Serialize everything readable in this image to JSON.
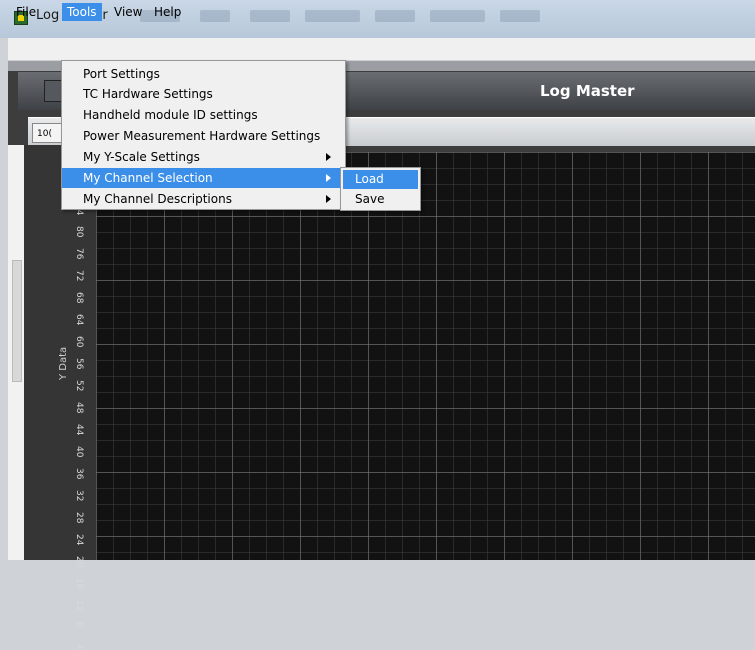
{
  "window": {
    "title": "Log Master"
  },
  "menubar": [
    {
      "label": "File"
    },
    {
      "label": "Tools"
    },
    {
      "label": "View"
    },
    {
      "label": "Help"
    }
  ],
  "app": {
    "header_title": "Log Master",
    "tab_label": "10("
  },
  "tools_menu": {
    "items": [
      {
        "label": "Port Settings",
        "submenu": false
      },
      {
        "label": "TC Hardware Settings",
        "submenu": false
      },
      {
        "label": "Handheld module  ID settings",
        "submenu": false
      },
      {
        "label": "Power Measurement Hardware Settings",
        "submenu": false
      },
      {
        "label": "My Y-Scale Settings",
        "submenu": true
      },
      {
        "label": "My Channel Selection",
        "submenu": true,
        "highlighted": true
      },
      {
        "label": "My Channel Descriptions",
        "submenu": true
      }
    ]
  },
  "channel_selection_submenu": {
    "items": [
      {
        "label": "Load",
        "highlighted": true
      },
      {
        "label": "Save"
      }
    ]
  },
  "plot": {
    "y_axis_label": "Y Data",
    "y_ticks": [
      "84",
      "80",
      "76",
      "72",
      "68",
      "64",
      "60",
      "56",
      "52",
      "48",
      "44",
      "40",
      "36",
      "32",
      "28",
      "24",
      "20",
      "16",
      "12",
      "8",
      "4"
    ]
  },
  "colors": {
    "menu_highlight": "#3b8fe8",
    "plot_background": "#121212",
    "header_bar": "#4a4d51"
  }
}
